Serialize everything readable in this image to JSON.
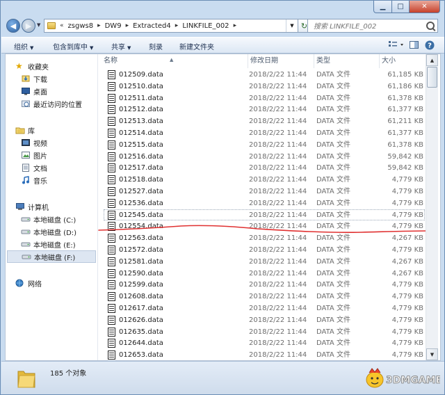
{
  "window": {
    "minimize_icon": "minimize-icon",
    "maximize_icon": "maximize-icon",
    "close_icon": "close-icon"
  },
  "address": {
    "overflow": "«",
    "breadcrumbs": [
      "zsgws8",
      "DW9",
      "Extracted4",
      "LINKFILE_002"
    ]
  },
  "search": {
    "placeholder": "搜索 LINKFILE_002"
  },
  "toolbar": {
    "organize": "组织",
    "include_in_library": "包含到库中",
    "share": "共享",
    "burn": "刻录",
    "new_folder": "新建文件夹"
  },
  "sidebar": {
    "favorites": {
      "label": "收藏夹",
      "items": [
        "下载",
        "桌面",
        "最近访问的位置"
      ]
    },
    "libraries": {
      "label": "库",
      "items": [
        "视频",
        "图片",
        "文档",
        "音乐"
      ]
    },
    "computer": {
      "label": "计算机",
      "items": [
        "本地磁盘 (C:)",
        "本地磁盘 (D:)",
        "本地磁盘 (E:)",
        "本地磁盘 (F:)"
      ]
    },
    "network": {
      "label": "网络"
    }
  },
  "columns": {
    "name": "名称",
    "date": "修改日期",
    "type": "类型",
    "size": "大小"
  },
  "files": [
    {
      "name": "012509.data",
      "date": "2018/2/22 11:44",
      "type": "DATA 文件",
      "size": "61,185 KB"
    },
    {
      "name": "012510.data",
      "date": "2018/2/22 11:44",
      "type": "DATA 文件",
      "size": "61,186 KB"
    },
    {
      "name": "012511.data",
      "date": "2018/2/22 11:44",
      "type": "DATA 文件",
      "size": "61,378 KB"
    },
    {
      "name": "012512.data",
      "date": "2018/2/22 11:44",
      "type": "DATA 文件",
      "size": "61,377 KB"
    },
    {
      "name": "012513.data",
      "date": "2018/2/22 11:44",
      "type": "DATA 文件",
      "size": "61,211 KB"
    },
    {
      "name": "012514.data",
      "date": "2018/2/22 11:44",
      "type": "DATA 文件",
      "size": "61,377 KB"
    },
    {
      "name": "012515.data",
      "date": "2018/2/22 11:44",
      "type": "DATA 文件",
      "size": "61,378 KB"
    },
    {
      "name": "012516.data",
      "date": "2018/2/22 11:44",
      "type": "DATA 文件",
      "size": "59,842 KB"
    },
    {
      "name": "012517.data",
      "date": "2018/2/22 11:44",
      "type": "DATA 文件",
      "size": "59,842 KB"
    },
    {
      "name": "012518.data",
      "date": "2018/2/22 11:44",
      "type": "DATA 文件",
      "size": "4,779 KB"
    },
    {
      "name": "012527.data",
      "date": "2018/2/22 11:44",
      "type": "DATA 文件",
      "size": "4,779 KB"
    },
    {
      "name": "012536.data",
      "date": "2018/2/22 11:44",
      "type": "DATA 文件",
      "size": "4,779 KB"
    },
    {
      "name": "012545.data",
      "date": "2018/2/22 11:44",
      "type": "DATA 文件",
      "size": "4,779 KB"
    },
    {
      "name": "012554.data",
      "date": "2018/2/22 11:44",
      "type": "DATA 文件",
      "size": "4,779 KB"
    },
    {
      "name": "012563.data",
      "date": "2018/2/22 11:44",
      "type": "DATA 文件",
      "size": "4,267 KB"
    },
    {
      "name": "012572.data",
      "date": "2018/2/22 11:44",
      "type": "DATA 文件",
      "size": "4,779 KB"
    },
    {
      "name": "012581.data",
      "date": "2018/2/22 11:44",
      "type": "DATA 文件",
      "size": "4,267 KB"
    },
    {
      "name": "012590.data",
      "date": "2018/2/22 11:44",
      "type": "DATA 文件",
      "size": "4,267 KB"
    },
    {
      "name": "012599.data",
      "date": "2018/2/22 11:44",
      "type": "DATA 文件",
      "size": "4,779 KB"
    },
    {
      "name": "012608.data",
      "date": "2018/2/22 11:44",
      "type": "DATA 文件",
      "size": "4,779 KB"
    },
    {
      "name": "012617.data",
      "date": "2018/2/22 11:44",
      "type": "DATA 文件",
      "size": "4,779 KB"
    },
    {
      "name": "012626.data",
      "date": "2018/2/22 11:44",
      "type": "DATA 文件",
      "size": "4,779 KB"
    },
    {
      "name": "012635.data",
      "date": "2018/2/22 11:44",
      "type": "DATA 文件",
      "size": "4,779 KB"
    },
    {
      "name": "012644.data",
      "date": "2018/2/22 11:44",
      "type": "DATA 文件",
      "size": "4,779 KB"
    },
    {
      "name": "012653.data",
      "date": "2018/2/22 11:44",
      "type": "DATA 文件",
      "size": "4,779 KB"
    }
  ],
  "status": {
    "count_text": "185 个对象"
  },
  "watermark": {
    "text": "3DMGAME"
  },
  "colors": {
    "annotation_line": "#e03030",
    "accent": "#3a6ea5"
  }
}
